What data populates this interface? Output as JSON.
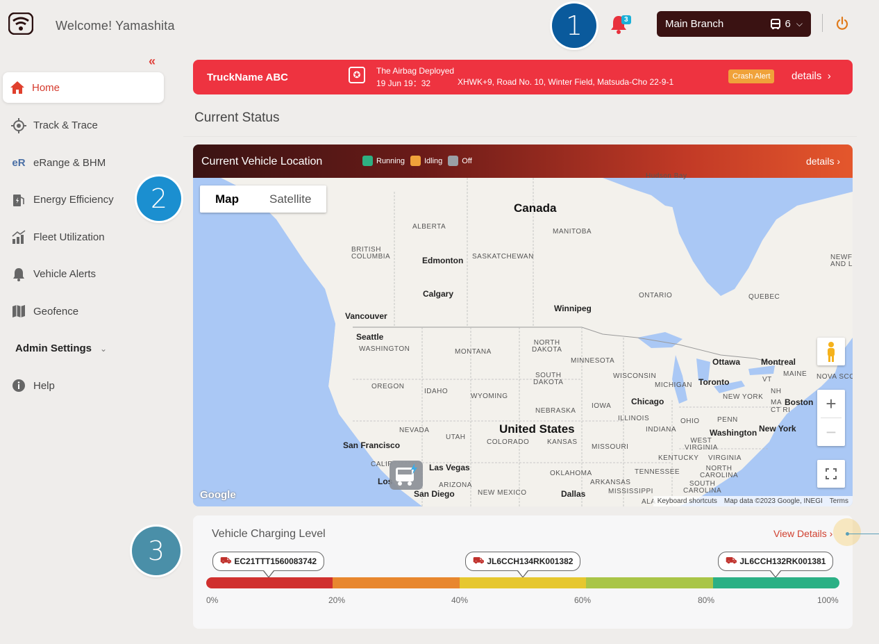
{
  "header": {
    "welcome": "Welcome! Yamashita",
    "notification_count": "3",
    "branch": "Main Branch",
    "vehicle_count": "6"
  },
  "steps": [
    "1",
    "2",
    "3"
  ],
  "sidebar": {
    "items": [
      {
        "label": "Home",
        "icon": "home-icon",
        "active": true
      },
      {
        "label": "Track & Trace",
        "icon": "target-icon"
      },
      {
        "label": "eRange & BHM",
        "icon": "erange-icon",
        "icon_text": "eR"
      },
      {
        "label": "Energy Efficiency",
        "icon": "fuel-icon"
      },
      {
        "label": "Fleet Utilization",
        "icon": "chart-icon"
      },
      {
        "label": "Vehicle Alerts",
        "icon": "bell-icon"
      },
      {
        "label": "Geofence",
        "icon": "map-icon"
      }
    ],
    "admin": "Admin Settings",
    "help": "Help"
  },
  "crash_alert": {
    "truck": "TruckName ABC",
    "title": "The Airbag Deployed",
    "time": "19 Jun 19：32",
    "address": "XHWK+9, Road No. 10, Winter Field, Matsuda-Cho 22-9-1",
    "badge": "Crash Alert",
    "details": "details"
  },
  "section_title": "Current Status",
  "map": {
    "title": "Current Vehicle Location",
    "legend": [
      {
        "label": "Running",
        "color": "#2eb082"
      },
      {
        "label": "Idling",
        "color": "#f0a23a"
      },
      {
        "label": "Off",
        "color": "#9aa0a6"
      }
    ],
    "details": "details",
    "toggle": {
      "map": "Map",
      "satellite": "Satellite"
    },
    "labels": {
      "hudson": "Hudson Bay",
      "canada": "Canada",
      "alberta": "ALBERTA",
      "manitoba": "MANITOBA",
      "bc": "BRITISH\nCOLUMBIA",
      "saskatchewan": "SASKATCHEWAN",
      "edmonton": "Edmonton",
      "calgary": "Calgary",
      "ontario": "ONTARIO",
      "quebec": "QUEBEC",
      "newfoundland": "NEWFO\nAND L",
      "winnipeg": "Winnipeg",
      "vancouver": "Vancouver",
      "seattle": "Seattle",
      "washington": "WASHINGTON",
      "montana": "MONTANA",
      "north_dakota": "NORTH\nDAKOTA",
      "minnesota": "MINNESOTA",
      "ottawa": "Ottawa",
      "montreal": "Montreal",
      "maine": "MAINE",
      "nova_scotia": "NOVA SCO",
      "south_dakota": "SOUTH\nDAKOTA",
      "wisconsin": "WISCONSIN",
      "michigan": "MICHIGAN",
      "toronto": "Toronto",
      "vt": "VT",
      "nh": "NH",
      "oregon": "OREGON",
      "idaho": "IDAHO",
      "wyoming": "WYOMING",
      "new_york": "NEW YORK",
      "ma": "MA",
      "boston": "Boston",
      "ct_ri": "CT RI",
      "iowa": "IOWA",
      "chicago": "Chicago",
      "nebraska": "NEBRASKA",
      "illinois": "ILLINOIS",
      "ohio": "OHIO",
      "penn": "PENN",
      "nevada": "NEVADA",
      "utah": "UTAH",
      "united_states": "United States",
      "colorado": "COLORADO",
      "kansas": "KANSAS",
      "indiana": "INDIANA",
      "washington_dc": "Washington",
      "new_york_city": "New York",
      "west_virginia": "WEST\nVIRGINIA",
      "virginia": "VIRGINIA",
      "san_francisco": "San Francisco",
      "missouri": "MISSOURI",
      "kentucky": "KENTUCKY",
      "calif": "CALIF",
      "las_vegas": "Las Vegas",
      "oklahoma": "OKLAHOMA",
      "tennessee": "TENNESSEE",
      "north_carolina": "NORTH\nCAROLINA",
      "los": "Los",
      "arizona": "ARIZONA",
      "san_diego": "San Diego",
      "new_mexico": "NEW MEXICO",
      "dallas": "Dallas",
      "arkansas": "ARKANSAS",
      "mississippi": "MISSISSIPPI",
      "south_carolina": "SOUTH\nCAROLINA",
      "ala": "ALA"
    },
    "google": "Google",
    "attribution": [
      "Keyboard shortcuts",
      "Map data ©2023 Google, INEGI",
      "Terms"
    ]
  },
  "charging": {
    "title": "Vehicle Charging Level",
    "view_details": "View Details",
    "vehicles": [
      {
        "id": "EC21TTT1560083742",
        "level_pct": 9.5
      },
      {
        "id": "JL6CCH134RK001382",
        "level_pct": 49.5
      },
      {
        "id": "JL6CCH132RK001381",
        "level_pct": 89.5
      }
    ],
    "bands": [
      "#d0302e",
      "#e8872e",
      "#e6c72f",
      "#a9c548",
      "#2bb085"
    ],
    "ticks": [
      "0%",
      "20%",
      "40%",
      "60%",
      "80%",
      "100%"
    ]
  }
}
